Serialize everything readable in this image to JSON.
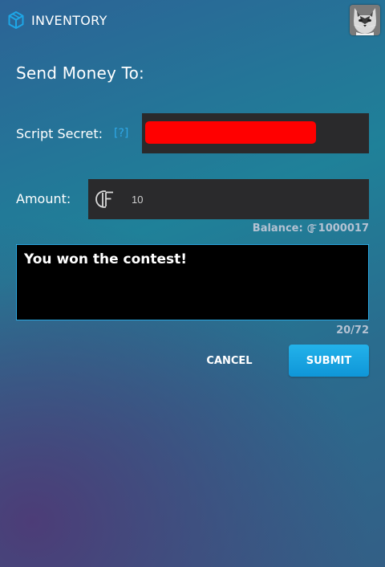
{
  "header": {
    "inventory_label": "INVENTORY",
    "inventory_icon": "cube-icon",
    "avatar_icon": "cat-avatar"
  },
  "form": {
    "title": "Send Money To:",
    "script_secret_label": "Script Secret:",
    "help_link": "[?]",
    "script_secret_value_redacted": true,
    "amount_label": "Amount:",
    "currency_icon": "currency-icon",
    "amount_value": "10",
    "balance_label": "Balance:",
    "balance_value": "1000017",
    "message_value": "You won the contest!",
    "char_count": "20/72",
    "cancel_label": "CANCEL",
    "submit_label": "SUBMIT"
  },
  "colors": {
    "accent": "#2aa6e0",
    "redaction": "#ff0000",
    "input_bg": "#2a2a2c"
  }
}
